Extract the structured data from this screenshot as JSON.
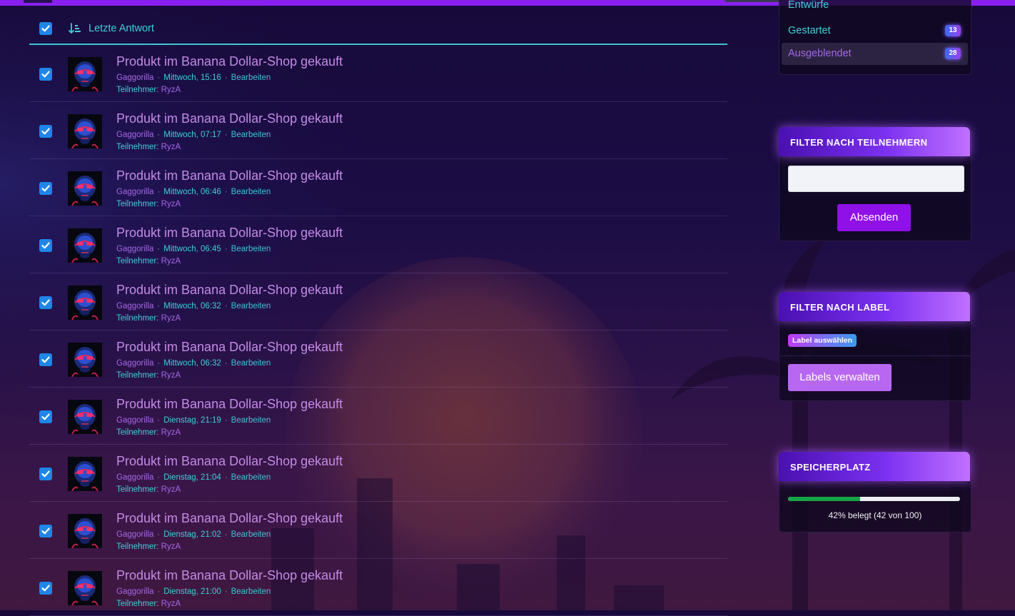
{
  "list": {
    "header": {
      "sort_label": "Letzte Antwort"
    },
    "rows": [
      {
        "title": "Produkt im Banana Dollar-Shop gekauft",
        "author": "Gaggorilla",
        "date": "Mittwoch, 15:16",
        "edit": "Bearbeiten",
        "participants_label": "Teilnehmer:",
        "participant": "RyzA"
      },
      {
        "title": "Produkt im Banana Dollar-Shop gekauft",
        "author": "Gaggorilla",
        "date": "Mittwoch, 07:17",
        "edit": "Bearbeiten",
        "participants_label": "Teilnehmer:",
        "participant": "RyzA"
      },
      {
        "title": "Produkt im Banana Dollar-Shop gekauft",
        "author": "Gaggorilla",
        "date": "Mittwoch, 06:46",
        "edit": "Bearbeiten",
        "participants_label": "Teilnehmer:",
        "participant": "RyzA"
      },
      {
        "title": "Produkt im Banana Dollar-Shop gekauft",
        "author": "Gaggorilla",
        "date": "Mittwoch, 06:45",
        "edit": "Bearbeiten",
        "participants_label": "Teilnehmer:",
        "participant": "RyzA"
      },
      {
        "title": "Produkt im Banana Dollar-Shop gekauft",
        "author": "Gaggorilla",
        "date": "Mittwoch, 06:32",
        "edit": "Bearbeiten",
        "participants_label": "Teilnehmer:",
        "participant": "RyzA"
      },
      {
        "title": "Produkt im Banana Dollar-Shop gekauft",
        "author": "Gaggorilla",
        "date": "Mittwoch, 06:32",
        "edit": "Bearbeiten",
        "participants_label": "Teilnehmer:",
        "participant": "RyzA"
      },
      {
        "title": "Produkt im Banana Dollar-Shop gekauft",
        "author": "Gaggorilla",
        "date": "Dienstag, 21:19",
        "edit": "Bearbeiten",
        "participants_label": "Teilnehmer:",
        "participant": "RyzA"
      },
      {
        "title": "Produkt im Banana Dollar-Shop gekauft",
        "author": "Gaggorilla",
        "date": "Dienstag, 21:04",
        "edit": "Bearbeiten",
        "participants_label": "Teilnehmer:",
        "participant": "RyzA"
      },
      {
        "title": "Produkt im Banana Dollar-Shop gekauft",
        "author": "Gaggorilla",
        "date": "Dienstag, 21:02",
        "edit": "Bearbeiten",
        "participants_label": "Teilnehmer:",
        "participant": "RyzA"
      },
      {
        "title": "Produkt im Banana Dollar-Shop gekauft",
        "author": "Gaggorilla",
        "date": "Dienstag, 21:00",
        "edit": "Bearbeiten",
        "participants_label": "Teilnehmer:",
        "participant": "RyzA"
      }
    ]
  },
  "sidebar": {
    "status": {
      "drafts_label": "Entwürfe",
      "started_label": "Gestartet",
      "started_count": "13",
      "hidden_label": "Ausgeblendet",
      "hidden_count": "28"
    },
    "participant_filter": {
      "title": "FILTER NACH TEILNEHMERN",
      "input_value": "",
      "submit_label": "Absenden"
    },
    "label_filter": {
      "title": "FILTER NACH LABEL",
      "chip_label": "Label auswählen",
      "manage_label": "Labels verwalten"
    },
    "storage": {
      "title": "SPEICHERPLATZ",
      "used_fraction": 0.42,
      "text": "42% belegt (42 von 100)"
    }
  },
  "icons": {
    "checkbox": "checkmark-icon",
    "sort": "sort-descending-icon",
    "avatar": "gorilla-avatar"
  },
  "colors": {
    "accent_cyan": "#3fd0d8",
    "accent_purple": "#9010e8",
    "title_violet": "#c48ae6",
    "checkbox_blue": "#1f86e8",
    "storage_green": "#18a548"
  }
}
